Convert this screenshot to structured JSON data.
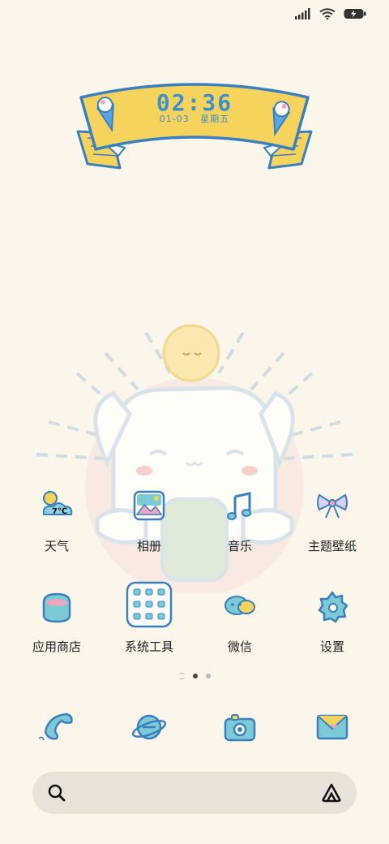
{
  "clock": {
    "time": "02:36",
    "date": "01-03",
    "weekday": "星期五"
  },
  "weather": {
    "temp": "7℃"
  },
  "apps_row1": [
    {
      "label": "天气",
      "icon": "weather-icon"
    },
    {
      "label": "相册",
      "icon": "gallery-icon"
    },
    {
      "label": "音乐",
      "icon": "music-icon"
    },
    {
      "label": "主题壁纸",
      "icon": "theme-bow-icon"
    }
  ],
  "apps_row2": [
    {
      "label": "应用商店",
      "icon": "app-store-icon"
    },
    {
      "label": "系统工具",
      "icon": "folder-icon"
    },
    {
      "label": "微信",
      "icon": "wechat-icon"
    },
    {
      "label": "设置",
      "icon": "gear-icon"
    }
  ],
  "dock": [
    {
      "icon": "phone-icon"
    },
    {
      "icon": "browser-icon"
    },
    {
      "icon": "camera-icon"
    },
    {
      "icon": "messages-icon"
    }
  ],
  "page_indicator": {
    "pages": 2,
    "current": 1
  },
  "colors": {
    "background": "#fbf5ea",
    "accent_blue": "#3f8fc9",
    "banner_yellow": "#f5d35c"
  }
}
